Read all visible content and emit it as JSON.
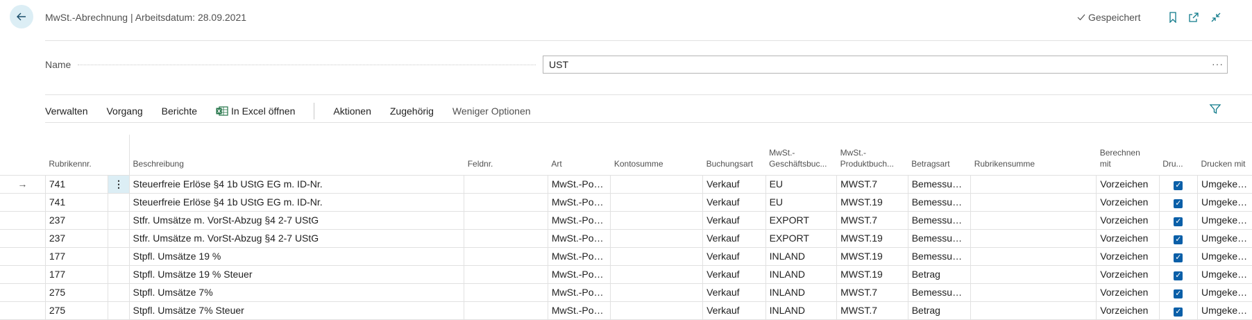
{
  "header": {
    "title": "MwSt.-Abrechnung | Arbeitsdatum: 28.09.2021",
    "saved_label": "Gespeichert"
  },
  "form": {
    "name_label": "Name",
    "name_value": "UST",
    "more_label": "···"
  },
  "actions": {
    "items": [
      "Verwalten",
      "Vorgang",
      "Berichte",
      "In Excel öffnen",
      "Aktionen",
      "Zugehörig",
      "Weniger Optionen"
    ]
  },
  "table": {
    "headers": {
      "rubrikennr": "Rubrikennr.",
      "beschreibung": "Beschreibung",
      "feldnr": "Feldnr.",
      "art": "Art",
      "kontosumme": "Kontosumme",
      "buchungsart": "Buchungsart",
      "mwst_gesch_1": "MwSt.-",
      "mwst_gesch_2": "Geschäftsbuc...",
      "mwst_prod_1": "MwSt.-",
      "mwst_prod_2": "Produktbuch...",
      "betragsart": "Betragsart",
      "rubrikensumme": "Rubrikensumme",
      "berechnen_1": "Berechnen",
      "berechnen_2": "mit",
      "drucken_short": "Dru...",
      "drucken_mit": "Drucken mit"
    },
    "row_marker": "→",
    "row_menu": "⋮",
    "rows": [
      {
        "nr": "741",
        "beschreibung": "Steuerfreie Erlöse §4 1b UStG EG m. ID-Nr.",
        "feldnr": "",
        "art": "MwSt.-Post...",
        "kontosumme": "",
        "buchungsart": "Verkauf",
        "geschaeft": "EU",
        "produkt": "MWST.7",
        "betragsart": "Bemessung...",
        "rubrikensumme": "",
        "berechnen": "Vorzeichen",
        "drucken": true,
        "drucken_mit": "Umgekehrt..."
      },
      {
        "nr": "741",
        "beschreibung": "Steuerfreie Erlöse §4 1b UStG EG m. ID-Nr.",
        "feldnr": "",
        "art": "MwSt.-Post...",
        "kontosumme": "",
        "buchungsart": "Verkauf",
        "geschaeft": "EU",
        "produkt": "MWST.19",
        "betragsart": "Bemessung...",
        "rubrikensumme": "",
        "berechnen": "Vorzeichen",
        "drucken": true,
        "drucken_mit": "Umgekehrt..."
      },
      {
        "nr": "237",
        "beschreibung": "Stfr. Umsätze m. VorSt-Abzug §4 2-7 UStG",
        "feldnr": "",
        "art": "MwSt.-Post...",
        "kontosumme": "",
        "buchungsart": "Verkauf",
        "geschaeft": "EXPORT",
        "produkt": "MWST.7",
        "betragsart": "Bemessung...",
        "rubrikensumme": "",
        "berechnen": "Vorzeichen",
        "drucken": true,
        "drucken_mit": "Umgekehrt..."
      },
      {
        "nr": "237",
        "beschreibung": "Stfr. Umsätze m. VorSt-Abzug §4 2-7 UStG",
        "feldnr": "",
        "art": "MwSt.-Post...",
        "kontosumme": "",
        "buchungsart": "Verkauf",
        "geschaeft": "EXPORT",
        "produkt": "MWST.19",
        "betragsart": "Bemessung...",
        "rubrikensumme": "",
        "berechnen": "Vorzeichen",
        "drucken": true,
        "drucken_mit": "Umgekehrt..."
      },
      {
        "nr": "177",
        "beschreibung": "Stpfl. Umsätze 19 %",
        "feldnr": "",
        "art": "MwSt.-Post...",
        "kontosumme": "",
        "buchungsart": "Verkauf",
        "geschaeft": "INLAND",
        "produkt": "MWST.19",
        "betragsart": "Bemessung...",
        "rubrikensumme": "",
        "berechnen": "Vorzeichen",
        "drucken": true,
        "drucken_mit": "Umgekehrt..."
      },
      {
        "nr": "177",
        "beschreibung": "Stpfl. Umsätze 19 % Steuer",
        "feldnr": "",
        "art": "MwSt.-Post...",
        "kontosumme": "",
        "buchungsart": "Verkauf",
        "geschaeft": "INLAND",
        "produkt": "MWST.19",
        "betragsart": "Betrag",
        "rubrikensumme": "",
        "berechnen": "Vorzeichen",
        "drucken": true,
        "drucken_mit": "Umgekehrt..."
      },
      {
        "nr": "275",
        "beschreibung": "Stpfl. Umsätze 7%",
        "feldnr": "",
        "art": "MwSt.-Post...",
        "kontosumme": "",
        "buchungsart": "Verkauf",
        "geschaeft": "INLAND",
        "produkt": "MWST.7",
        "betragsart": "Bemessung...",
        "rubrikensumme": "",
        "berechnen": "Vorzeichen",
        "drucken": true,
        "drucken_mit": "Umgekehrt..."
      },
      {
        "nr": "275",
        "beschreibung": "Stpfl. Umsätze 7% Steuer",
        "feldnr": "",
        "art": "MwSt.-Post...",
        "kontosumme": "",
        "buchungsart": "Verkauf",
        "geschaeft": "INLAND",
        "produkt": "MWST.7",
        "betragsart": "Betrag",
        "rubrikensumme": "",
        "berechnen": "Vorzeichen",
        "drucken": true,
        "drucken_mit": "Umgekehrt..."
      }
    ]
  },
  "colors": {
    "accent": "#0f7a8a",
    "selected_cell": "#dceef5",
    "checkbox": "#0a5fa8"
  },
  "icons": {
    "back": "arrow-left-icon",
    "saved": "checkmark-icon",
    "bookmark": "bookmark-icon",
    "open_new": "open-in-new-window-icon",
    "collapse": "collapse-icon",
    "excel": "excel-icon",
    "filter": "filter-icon"
  }
}
